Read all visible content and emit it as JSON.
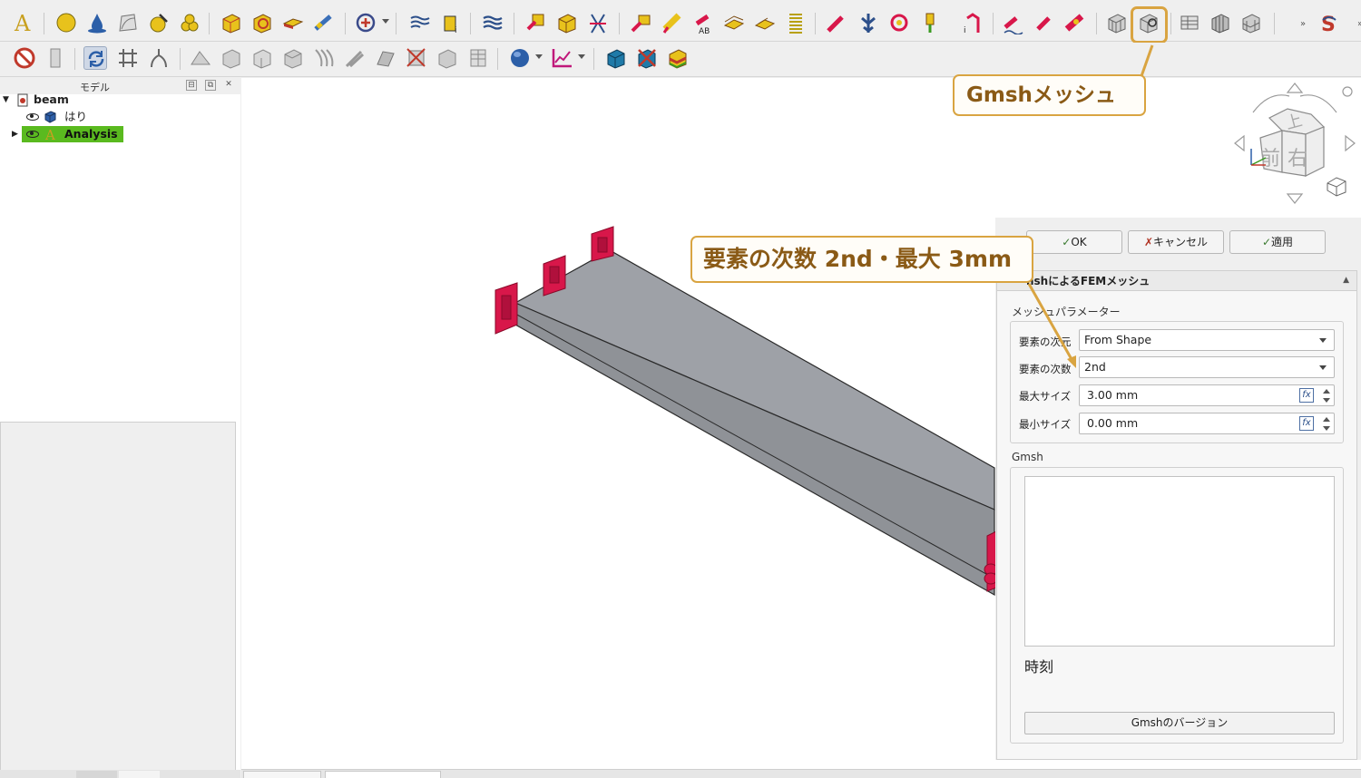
{
  "tree": {
    "panel_title": "モデル",
    "root_label": "beam",
    "child1_label": "はり",
    "child2_label": "Analysis"
  },
  "task_panel": {
    "ok_label": "OK",
    "cancel_label": "キャンセル",
    "apply_label": "適用",
    "section_title": "GmshによるFEMメッシュ",
    "section_title_visible": "nshによるFEMメッシュ",
    "mesh_params_label": "メッシュパラメーター",
    "element_dimension_label": "要素の次元",
    "element_dimension_value": "From Shape",
    "element_order_label": "要素の次数",
    "element_order_value": "2nd",
    "max_size_label": "最大サイズ",
    "max_size_value": "3.00 mm",
    "min_size_label": "最小サイズ",
    "min_size_value": "0.00 mm",
    "gmsh_group_label": "Gmsh",
    "time_label": "時刻",
    "version_button_label": "Gmshのバージョン"
  },
  "callouts": {
    "gmsh_mesh": "Gmshメッシュ",
    "order_size": "要素の次数 2nd・最大 3mm"
  },
  "navcube": {
    "top": "上",
    "front": "前",
    "right": "右"
  },
  "colors": {
    "accent": "#d9a441",
    "callout_text": "#8a5a16",
    "analysis_highlight": "#5aba1f",
    "constraint_red": "#d8174a",
    "beam_gray": "#9ea1a7"
  }
}
